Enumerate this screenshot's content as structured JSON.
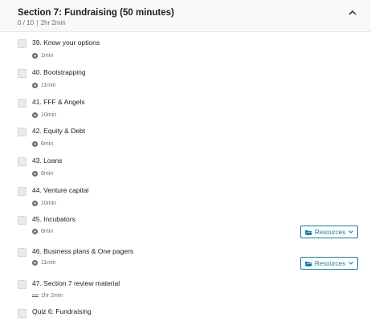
{
  "section": {
    "title": "Section 7: Fundraising (50 minutes)",
    "progress": "0 / 10",
    "duration": "2hr 2min",
    "expanded": true
  },
  "items": [
    {
      "title": "39. Know your options",
      "duration": "1min",
      "type": "video",
      "completed": false
    },
    {
      "title": "40. Bootstrapping",
      "duration": "11min",
      "type": "video",
      "completed": false
    },
    {
      "title": "41. FFF & Angels",
      "duration": "10min",
      "type": "video",
      "completed": false
    },
    {
      "title": "42. Equity & Debt",
      "duration": "6min",
      "type": "video",
      "completed": false
    },
    {
      "title": "43. Loans",
      "duration": "6min",
      "type": "video",
      "completed": false
    },
    {
      "title": "44. Venture capital",
      "duration": "10min",
      "type": "video",
      "completed": false
    },
    {
      "title": "45. Incubators",
      "duration": "6min",
      "type": "video",
      "completed": false,
      "resources_label": "Resources"
    },
    {
      "title": "46. Business plans & One pagers",
      "duration": "11min",
      "type": "video",
      "completed": false,
      "resources_label": "Resources"
    },
    {
      "title": "47. Section 7 review material",
      "duration": "1hr 2min",
      "type": "document",
      "completed": false
    },
    {
      "title": "Quiz 6: Fundraising",
      "type": "quiz",
      "completed": false
    }
  ],
  "colors": {
    "accent": "#1c7c9c",
    "header_bg": "#f7f9fa",
    "meta_text": "#6a6f73"
  }
}
